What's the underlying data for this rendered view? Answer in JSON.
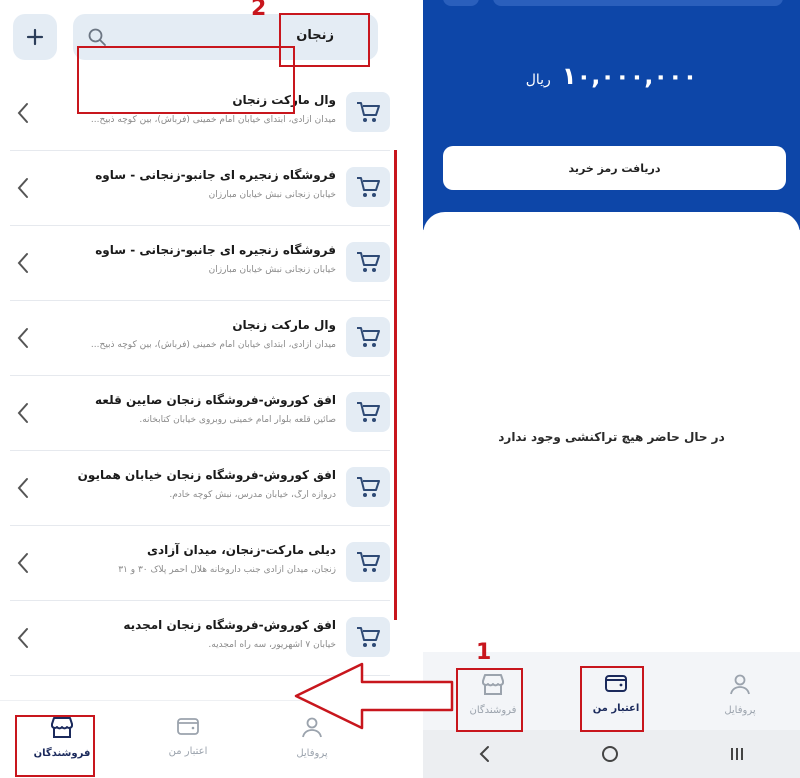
{
  "left": {
    "search": {
      "value": "زنجان"
    },
    "stores": [
      {
        "name": "وال مارکت زنجان",
        "address": "میدان آزادی، ابتدای خیابان امام خمینی (فرباش)، بین کوچه ذبیح..."
      },
      {
        "name": "فروشگاه زنجیره ای جانبو-زنجانی - ساوه",
        "address": "خیابان زنجانی نبش خیابان مبارزان"
      },
      {
        "name": "فروشگاه زنجیره ای جانبو-زنجانی - ساوه",
        "address": "خیابان زنجانی نبش خیابان مبارزان"
      },
      {
        "name": "وال مارکت زنجان",
        "address": "میدان آزادی، ابتدای خیابان امام خمینی (فرباش)، بین کوچه ذبیح..."
      },
      {
        "name": "افق کوروش-فروشگاه زنجان صایین قلعه",
        "address": "صائین قلعه بلوار امام خمینی روبروی خیابان کتابخانه."
      },
      {
        "name": "افق کوروش-فروشگاه زنجان خیابان همایون",
        "address": "دروازه ارگ، خیابان مدرس، نبش کوچه خادم."
      },
      {
        "name": "دیلی مارکت-زنجان، میدان آزادی",
        "address": "زنجان، میدان آزادی جنب داروخانه هلال احمر پلاک ۳۰ و ۳۱"
      },
      {
        "name": "افق کوروش-فروشگاه زنجان امجدیه",
        "address": "خیابان ۷ اشهریور، سه راه امجدیه."
      }
    ],
    "nav": {
      "vendors": "فروشندگان",
      "credit": "اعتبار من",
      "profile": "پروفایل"
    }
  },
  "right": {
    "balance": {
      "amount": "۱۰,۰۰۰,۰۰۰",
      "currency": "ریال"
    },
    "buy_code_label": "دریافت رمز خرید",
    "empty_message": "در حال حاضر هیچ تراکنشی وجود ندارد",
    "nav": {
      "vendors": "فروشندگان",
      "credit": "اعتبار من",
      "profile": "پروفایل"
    }
  },
  "annotations": {
    "step1": "1",
    "step2": "2"
  },
  "colors": {
    "primary_blue": "#0d46a8",
    "nav_active": "#1b2a5c",
    "highlight_red": "#c8161d",
    "chip_bg": "#e4ecf4"
  },
  "icons": [
    "plus-icon",
    "search-icon",
    "cart-icon",
    "chevron-left-icon",
    "store-icon",
    "wallet-icon",
    "user-icon"
  ]
}
